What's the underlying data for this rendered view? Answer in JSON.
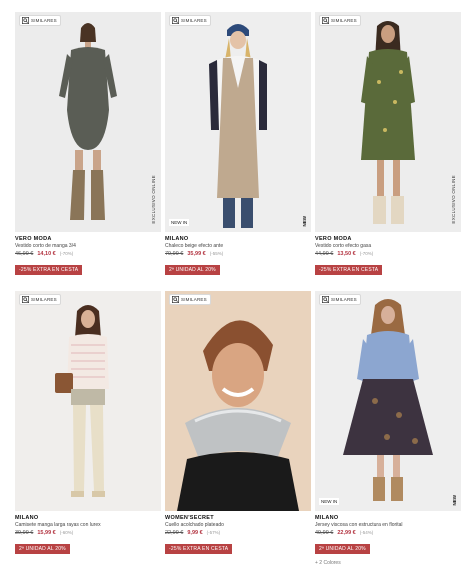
{
  "similar_label": "SIMILARES",
  "products": [
    {
      "brand": "VERO MODA",
      "name": "Vestido corto de manga 3/4",
      "old_price": "46,99 €",
      "new_price": "14,10 €",
      "discount": "(-70%)",
      "badge": "-25% EXTRA EN CESTA",
      "side_tag": "EXCLUSIVO ONLINE",
      "new_in": "",
      "new_vertical": ""
    },
    {
      "brand": "MILANO",
      "name": "Chaleco beige efecto ante",
      "old_price": "79,99 €",
      "new_price": "35,99 €",
      "discount": "(-55%)",
      "badge": "2ª UNIDAD AL 20%",
      "side_tag": "",
      "new_in": "NEW IN",
      "new_vertical": "NEW"
    },
    {
      "brand": "VERO MODA",
      "name": "Vestido corto efecto gasa",
      "old_price": "44,99 €",
      "new_price": "13,50 €",
      "discount": "(-70%)",
      "badge": "-25% EXTRA EN CESTA",
      "side_tag": "EXCLUSIVO ONLINE",
      "new_in": "",
      "new_vertical": ""
    },
    {
      "brand": "MILANO",
      "name": "Camisete manga larga rayas con lurex",
      "old_price": "39,99 €",
      "new_price": "15,99 €",
      "discount": "(-60%)",
      "badge": "2ª UNIDAD AL 20%",
      "side_tag": "",
      "new_in": "",
      "new_vertical": ""
    },
    {
      "brand": "WOMEN'SECRET",
      "name": "Cuello acolchado plateado",
      "old_price": "22,99 €",
      "new_price": "9,99 €",
      "discount": "(-57%)",
      "badge": "-25% EXTRA EN CESTA",
      "side_tag": "",
      "new_in": "",
      "new_vertical": ""
    },
    {
      "brand": "MILANO",
      "name": "Jersey viscosa con estructura en florital",
      "old_price": "49,99 €",
      "new_price": "22,99 €",
      "discount": "(-54%)",
      "badge": "2ª UNIDAD AL 20%",
      "side_tag": "",
      "new_in": "NEW IN",
      "new_vertical": "NEW",
      "colors_link": "+ 2 Colores"
    }
  ],
  "colors": {
    "badge": "#b84243",
    "sale_price": "#b2323f"
  }
}
